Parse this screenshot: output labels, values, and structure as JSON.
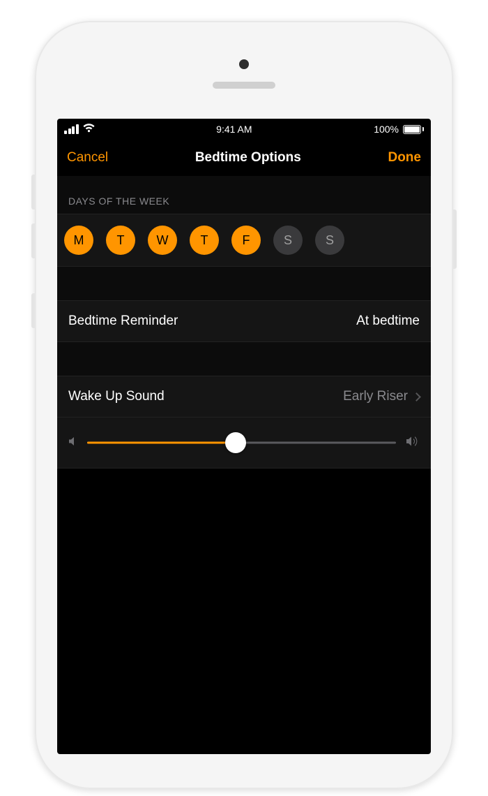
{
  "status": {
    "time": "9:41 AM",
    "battery_text": "100%"
  },
  "nav": {
    "cancel": "Cancel",
    "title": "Bedtime Options",
    "done": "Done"
  },
  "days_header": "DAYS OF THE WEEK",
  "days": [
    {
      "label": "M",
      "selected": true
    },
    {
      "label": "T",
      "selected": true
    },
    {
      "label": "W",
      "selected": true
    },
    {
      "label": "T",
      "selected": true
    },
    {
      "label": "F",
      "selected": true
    },
    {
      "label": "S",
      "selected": false
    },
    {
      "label": "S",
      "selected": false
    }
  ],
  "reminder": {
    "label": "Bedtime Reminder",
    "value": "At bedtime"
  },
  "sound": {
    "label": "Wake Up Sound",
    "value": "Early Riser"
  },
  "volume_percent": 48,
  "colors": {
    "accent": "#ff9500"
  }
}
